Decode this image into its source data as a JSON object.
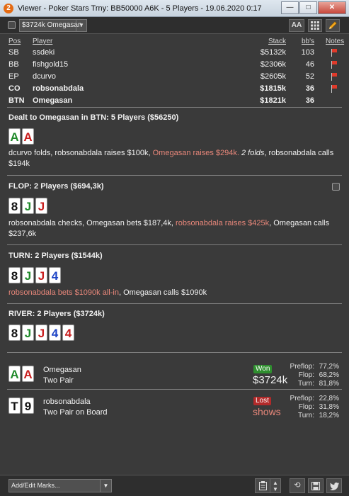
{
  "window": {
    "title": "Viewer - Poker Stars Trny: BB50000 A6K - 5 Players - 19.06.2020 0:17",
    "app_icon": "2",
    "minimize": "—",
    "maximize": "□",
    "close": "✕"
  },
  "toolbar": {
    "seat_select": "$3724k Omegasan",
    "font_button": "AA",
    "grid_icon": "grid-icon",
    "edit_icon": "pencil-icon"
  },
  "players": {
    "headers": {
      "pos": "Pos",
      "player": "Player",
      "stack": "Stack",
      "bbs": "bb's",
      "notes": "Notes"
    },
    "rows": [
      {
        "pos": "SB",
        "name": "ssdeki",
        "stack": "$5132k",
        "bbs": "103",
        "note": true,
        "bold": false
      },
      {
        "pos": "BB",
        "name": "fishgold15",
        "stack": "$2306k",
        "bbs": "46",
        "note": true,
        "bold": false
      },
      {
        "pos": "EP",
        "name": "dcurvo",
        "stack": "$2605k",
        "bbs": "52",
        "note": true,
        "bold": false
      },
      {
        "pos": "CO",
        "name": "robsonabdala",
        "stack": "$1815k",
        "bbs": "36",
        "note": true,
        "bold": true
      },
      {
        "pos": "BTN",
        "name": "Omegasan",
        "stack": "$1821k",
        "bbs": "36",
        "note": false,
        "bold": true
      }
    ]
  },
  "preflop": {
    "title": "Dealt to Omegasan in BTN: 5 Players ($56250)",
    "cards": [
      {
        "rank": "A",
        "suit": "club"
      },
      {
        "rank": "A",
        "suit": "heart"
      }
    ],
    "actions": [
      {
        "text": "dcurvo folds, robsonabdala raises $100k, ",
        "style": ""
      },
      {
        "text": "Omegasan raises $294k.",
        "style": "hl"
      },
      {
        "text": " ",
        "style": ""
      },
      {
        "text": "2 folds",
        "style": "it"
      },
      {
        "text": ", robsonabdala calls $194k",
        "style": ""
      }
    ]
  },
  "flop": {
    "title": "FLOP: 2 Players ($694,3k)",
    "cards": [
      {
        "rank": "8",
        "suit": "spade"
      },
      {
        "rank": "J",
        "suit": "club"
      },
      {
        "rank": "J",
        "suit": "heart"
      }
    ],
    "actions": [
      {
        "text": "robsonabdala checks, Omegasan bets $187,4k, ",
        "style": ""
      },
      {
        "text": "robsonabdala raises $425k",
        "style": "hl"
      },
      {
        "text": ", Omegasan calls $237,6k",
        "style": ""
      }
    ]
  },
  "turn": {
    "title": "TURN: 2 Players ($1544k)",
    "cards": [
      {
        "rank": "8",
        "suit": "spade"
      },
      {
        "rank": "J",
        "suit": "club"
      },
      {
        "rank": "J",
        "suit": "heart"
      },
      {
        "rank": "4",
        "suit": "diamond"
      }
    ],
    "actions": [
      {
        "text": "robsonabdala bets $1090k all-in",
        "style": "hl"
      },
      {
        "text": ", Omegasan calls $1090k",
        "style": ""
      }
    ]
  },
  "river": {
    "title": "RIVER: 2 Players ($3724k)",
    "cards": [
      {
        "rank": "8",
        "suit": "spade"
      },
      {
        "rank": "J",
        "suit": "club"
      },
      {
        "rank": "J",
        "suit": "heart"
      },
      {
        "rank": "4",
        "suit": "diamond"
      },
      {
        "rank": "4",
        "suit": "heart"
      }
    ]
  },
  "results": [
    {
      "name": "Omegasan",
      "hand": "Two Pair",
      "badge": "Won",
      "badge_type": "won",
      "amount": "$3724k",
      "cards": [
        {
          "rank": "A",
          "suit": "club"
        },
        {
          "rank": "A",
          "suit": "heart"
        }
      ],
      "stats": [
        {
          "label": "Preflop:",
          "value": "77,2%"
        },
        {
          "label": "Flop:",
          "value": "68,2%"
        },
        {
          "label": "Turn:",
          "value": "81,8%"
        }
      ]
    },
    {
      "name": "robsonabdala",
      "hand": "Two Pair on Board",
      "badge": "Lost",
      "badge_type": "lost",
      "amount": "shows",
      "cards": [
        {
          "rank": "T",
          "suit": "spade"
        },
        {
          "rank": "9",
          "suit": "spade"
        }
      ],
      "stats": [
        {
          "label": "Preflop:",
          "value": "22,8%"
        },
        {
          "label": "Flop:",
          "value": "31,8%"
        },
        {
          "label": "Turn:",
          "value": "18,2%"
        }
      ]
    }
  ],
  "bottom": {
    "marks_select": "Add/Edit Marks...",
    "buttons": [
      "clipboard-icon",
      "sort-icon",
      "refresh-icon",
      "save-icon",
      "twitter-icon"
    ]
  },
  "colors": {
    "highlight": "#e8877a",
    "won": "#2f8f2f",
    "lost": "#b22a2a",
    "flag": "#e03a2a"
  }
}
